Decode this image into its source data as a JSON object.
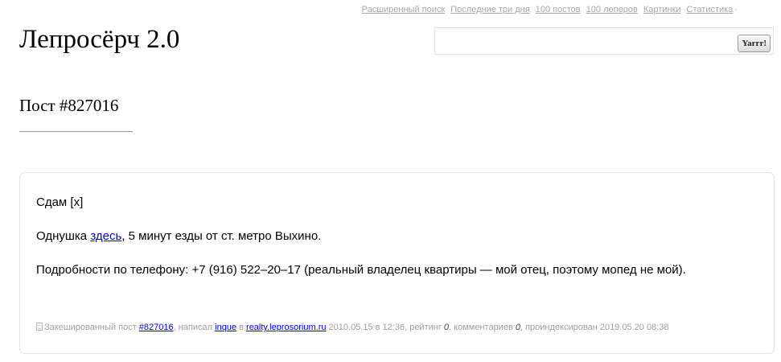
{
  "nav": {
    "links": [
      "Расширенный поиск",
      "Последние три дня",
      "100 постов",
      "100 леперов",
      "Картинки",
      "Статистика"
    ],
    "trailing": "·"
  },
  "header": {
    "logo": "Лепросёрч 2.0"
  },
  "search": {
    "value": "",
    "button_label": "Yarrr!"
  },
  "post": {
    "title": "Пост #827016",
    "line1": "Сдам [x]",
    "line2": {
      "before": "Однушка ",
      "link": "здесь",
      "after": ", 5 минут езды от ст. метро Выхино."
    },
    "line3": "Подробности по телефону: +7 (916) 522–20–17 (реальный владелец квартиры — мой отец, поэтому мопед не мой).",
    "meta": {
      "cached_label": "Закешированный пост",
      "post_link": "#827016",
      "author_prefix": ", написал",
      "author": "inque",
      "in_label": "в",
      "site": "realty.leprosorium.ru",
      "date": "2010.05.15 в 12:36, рейтинг",
      "rating": "0",
      "comments_label": ", комментариев",
      "comments": "0",
      "indexed": ", проиндексирован 2019.05.20 08:38"
    }
  }
}
